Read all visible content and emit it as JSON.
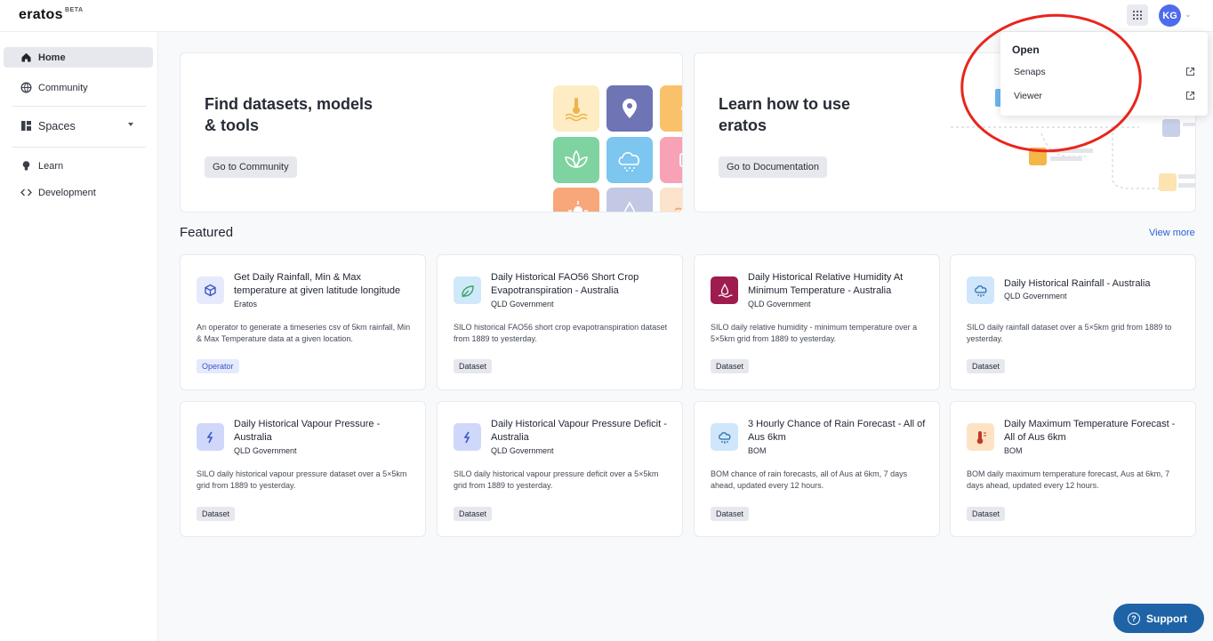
{
  "app": {
    "logo": "eratos",
    "badge": "BETA"
  },
  "header": {
    "avatar_initials": "KG",
    "apps_icon": "grid-icon"
  },
  "sidebar": {
    "items": [
      {
        "label": "Home",
        "icon": "home-icon"
      },
      {
        "label": "Community",
        "icon": "globe-icon"
      },
      {
        "label": "Spaces",
        "icon": "spaces-icon"
      },
      {
        "label": "Learn",
        "icon": "lightbulb-icon"
      },
      {
        "label": "Development",
        "icon": "code-icon"
      }
    ]
  },
  "hero": {
    "community": {
      "title": "Find datasets, models & tools",
      "button": "Go to Community"
    },
    "docs": {
      "title": "Learn how to use eratos",
      "button": "Go to Documentation"
    }
  },
  "featured": {
    "title": "Featured",
    "view_more": "View more",
    "cards": [
      {
        "title": "Get Daily Rainfall, Min & Max temperature at given latitude longitude",
        "publisher": "Eratos",
        "description": "An operator to generate a timeseries csv of 5km rainfall, Min & Max Temperature data at a given location.",
        "tag": "Operator",
        "icon": "cube-icon",
        "icon_bg": "#e6eafc"
      },
      {
        "title": "Daily Historical FAO56 Short Crop Evapotranspiration - Australia",
        "publisher": "QLD Government",
        "description": "SILO historical FAO56 short crop evapotranspiration dataset from 1889 to yesterday.",
        "tag": "Dataset",
        "icon": "leaf-icon",
        "icon_bg": "#cfe9fb"
      },
      {
        "title": "Daily Historical Relative Humidity At Minimum Temperature - Australia",
        "publisher": "QLD Government",
        "description": "SILO daily relative humidity - minimum temperature over a 5×5km grid from 1889 to yesterday.",
        "tag": "Dataset",
        "icon": "humidity-icon",
        "icon_bg": "#9e1c4e"
      },
      {
        "title": "Daily Historical Rainfall - Australia",
        "publisher": "QLD Government",
        "description": "SILO daily rainfall dataset over a 5×5km grid from 1889 to yesterday.",
        "tag": "Dataset",
        "icon": "rain-cloud-icon",
        "icon_bg": "#cfe6fb"
      },
      {
        "title": "Daily Historical Vapour Pressure - Australia",
        "publisher": "QLD Government",
        "description": "SILO daily historical vapour pressure dataset over a 5×5km grid from 1889 to yesterday.",
        "tag": "Dataset",
        "icon": "vapour-icon",
        "icon_bg": "#cfd8fb"
      },
      {
        "title": "Daily Historical Vapour Pressure Deficit - Australia",
        "publisher": "QLD Government",
        "description": "SILO daily historical vapour pressure deficit over a 5×5km grid from 1889 to yesterday.",
        "tag": "Dataset",
        "icon": "vapour-icon",
        "icon_bg": "#cfd8fb"
      },
      {
        "title": "3 Hourly Chance of Rain Forecast - All of Aus 6km",
        "publisher": "BOM",
        "description": "BOM chance of rain forecasts, all of Aus at 6km, 7 days ahead, updated every 12 hours.",
        "tag": "Dataset",
        "icon": "rain-cloud-icon",
        "icon_bg": "#cfe6fb"
      },
      {
        "title": "Daily Maximum Temperature Forecast - All of Aus 6km",
        "publisher": "BOM",
        "description": "BOM daily maximum temperature forecast, Aus at 6km, 7 days ahead, updated every 12 hours.",
        "tag": "Dataset",
        "icon": "thermometer-icon",
        "icon_bg": "#fde3c4"
      }
    ]
  },
  "dropdown": {
    "heading": "Open",
    "items": [
      {
        "label": "Senaps"
      },
      {
        "label": "Viewer"
      }
    ]
  },
  "support": {
    "label": "Support"
  },
  "colors": {
    "accent": "#4f6bed",
    "link": "#2b5fd9",
    "support": "#1e63a6",
    "annotation": "#e8251c"
  }
}
